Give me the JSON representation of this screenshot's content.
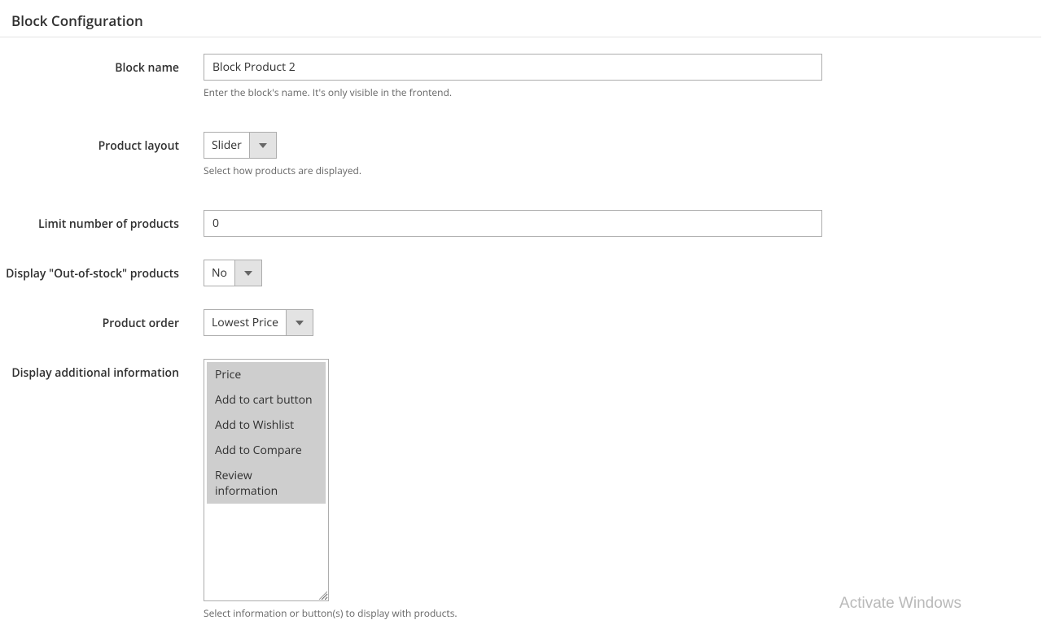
{
  "section": {
    "heading": "Block Configuration"
  },
  "fields": {
    "block_name": {
      "label": "Block name",
      "value": "Block Product 2",
      "hint": "Enter the block's name. It's only visible in the frontend."
    },
    "product_layout": {
      "label": "Product layout",
      "value": "Slider",
      "hint": "Select how products are displayed."
    },
    "limit": {
      "label": "Limit number of products",
      "value": "0"
    },
    "out_of_stock": {
      "label": "Display \"Out-of-stock\" products",
      "value": "No"
    },
    "product_order": {
      "label": "Product order",
      "value": "Lowest Price"
    },
    "additional_info": {
      "label": "Display additional information",
      "options": [
        "Price",
        "Add to cart button",
        "Add to Wishlist",
        "Add to Compare",
        "Review information"
      ],
      "hint": "Select information or button(s) to display with products."
    }
  },
  "watermark": "Activate Windows"
}
